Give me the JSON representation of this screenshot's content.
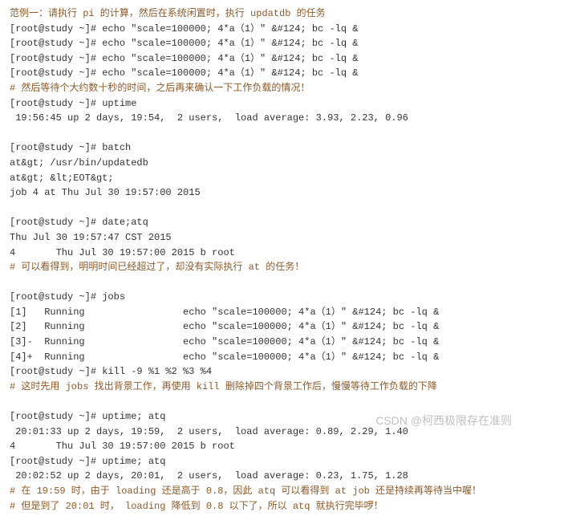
{
  "lines": [
    {
      "t": "范例一：请执行 pi 的计算，然后在系统闲置时，执行 updatdb 的任务",
      "cmt": true
    },
    {
      "t": "[root@study ~]# echo \"scale=100000; 4*a（1）\" &#124; bc -lq &"
    },
    {
      "t": "[root@study ~]# echo \"scale=100000; 4*a（1）\" &#124; bc -lq &"
    },
    {
      "t": "[root@study ~]# echo \"scale=100000; 4*a（1）\" &#124; bc -lq &"
    },
    {
      "t": "[root@study ~]# echo \"scale=100000; 4*a（1）\" &#124; bc -lq &"
    },
    {
      "t": "# 然后等待个大约数十秒的时间，之后再来确认一下工作负载的情况！",
      "cmt": true
    },
    {
      "t": "[root@study ~]# uptime"
    },
    {
      "t": " 19:56:45 up 2 days, 19:54,  2 users,  load average: 3.93, 2.23, 0.96"
    },
    {
      "t": ""
    },
    {
      "t": "[root@study ~]# batch"
    },
    {
      "t": "at&gt; /usr/bin/updatedb"
    },
    {
      "t": "at&gt; &lt;EOT&gt;"
    },
    {
      "t": "job 4 at Thu Jul 30 19:57:00 2015"
    },
    {
      "t": ""
    },
    {
      "t": "[root@study ~]# date;atq"
    },
    {
      "t": "Thu Jul 30 19:57:47 CST 2015"
    },
    {
      "t": "4       Thu Jul 30 19:57:00 2015 b root"
    },
    {
      "t": "# 可以看得到，明明时间已经超过了，却没有实际执行 at 的任务！",
      "cmt": true
    },
    {
      "t": ""
    },
    {
      "t": "[root@study ~]# jobs"
    },
    {
      "t": "[1]   Running                 echo \"scale=100000; 4*a（1）\" &#124; bc -lq &"
    },
    {
      "t": "[2]   Running                 echo \"scale=100000; 4*a（1）\" &#124; bc -lq &"
    },
    {
      "t": "[3]-  Running                 echo \"scale=100000; 4*a（1）\" &#124; bc -lq &"
    },
    {
      "t": "[4]+  Running                 echo \"scale=100000; 4*a（1）\" &#124; bc -lq &"
    },
    {
      "t": "[root@study ~]# kill -9 %1 %2 %3 %4"
    },
    {
      "t": "# 这时先用 jobs 找出背景工作，再使用 kill 删除掉四个背景工作后，慢慢等待工作负载的下降",
      "cmt": true
    },
    {
      "t": ""
    },
    {
      "t": "[root@study ~]# uptime; atq"
    },
    {
      "t": " 20:01:33 up 2 days, 19:59,  2 users,  load average: 0.89, 2.29, 1.40"
    },
    {
      "t": "4       Thu Jul 30 19:57:00 2015 b root"
    },
    {
      "t": "[root@study ~]# uptime; atq"
    },
    {
      "t": " 20:02:52 up 2 days, 20:01,  2 users,  load average: 0.23, 1.75, 1.28"
    },
    {
      "t": "# 在 19:59 时，由于 loading 还是高于 0.8，因此 atq 可以看得到 at job 还是持续再等待当中喔！",
      "cmt": true
    },
    {
      "t": "# 但是到了 20:01 时， loading 降低到 0.8 以下了，所以 atq 就执行完毕啰！",
      "cmt": true
    }
  ],
  "watermark": "CSDN @柯西极限存在准则"
}
